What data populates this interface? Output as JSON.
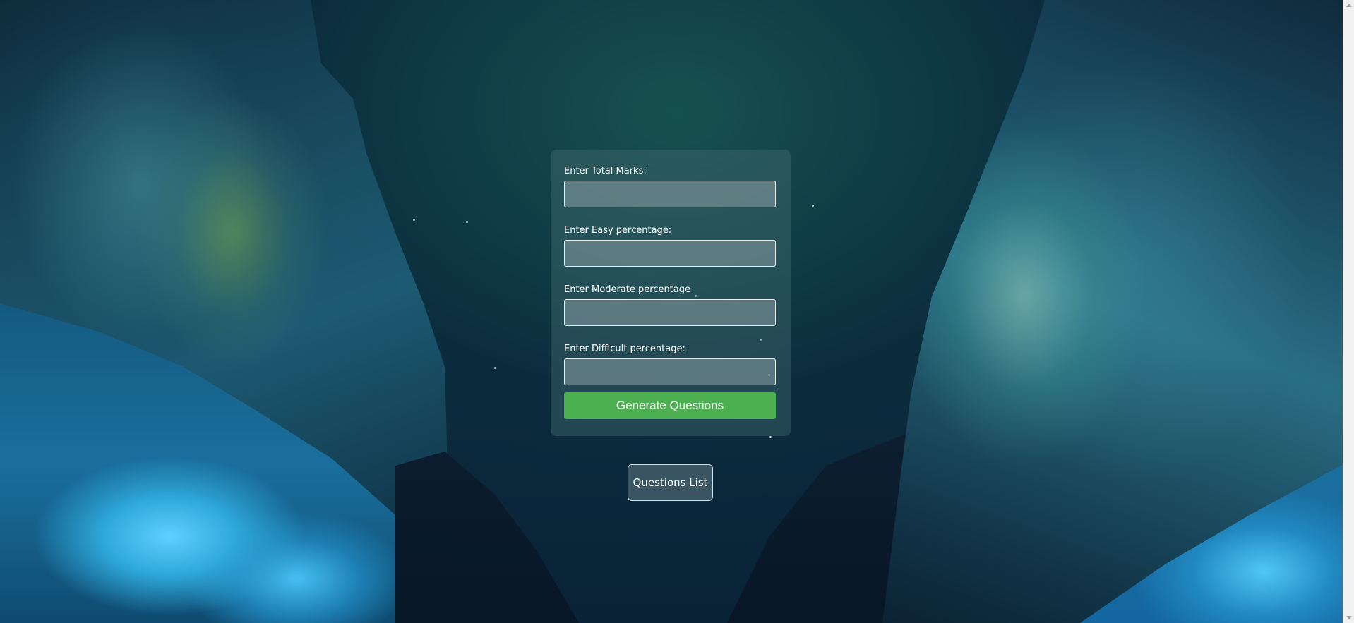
{
  "form": {
    "fields": [
      {
        "label": "Enter Total Marks:",
        "value": ""
      },
      {
        "label": "Enter Easy percentage:",
        "value": ""
      },
      {
        "label": "Enter Moderate percentage",
        "value": ""
      },
      {
        "label": "Enter Difficult percentage:",
        "value": ""
      }
    ],
    "submit_label": "Generate Questions"
  },
  "questions_list_label": "Questions List",
  "colors": {
    "generate_button": "#4caf50",
    "text": "#ffffff"
  }
}
